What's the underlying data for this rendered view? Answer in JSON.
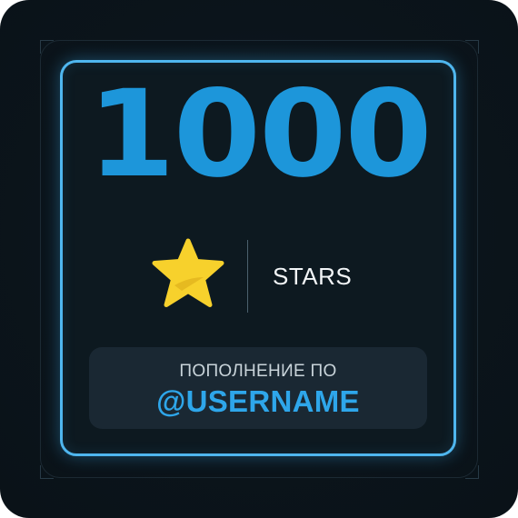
{
  "card": {
    "amount": "1000",
    "unit": "STARS",
    "topup_label": "ПОПОЛНЕНИЕ ПО",
    "username": "@USERNAME",
    "star_icon": "star-icon"
  },
  "colors": {
    "accent": "#1d96da",
    "frame": "#4fb6ee",
    "star": "#f7d12c",
    "background": "#0b141b"
  }
}
